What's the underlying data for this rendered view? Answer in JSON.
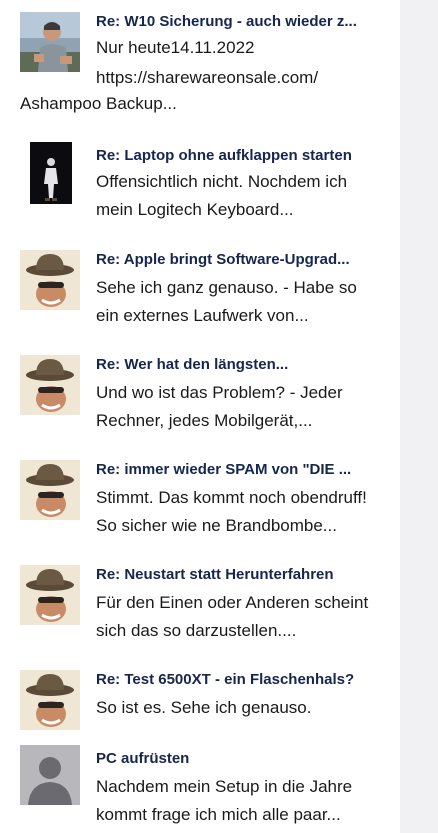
{
  "posts": [
    {
      "title": "Re: W10 Sicherung - auch wieder z...",
      "lines": [
        "Nur heute14.11.2022",
        "https://sharewareonsale.com/",
        "Ashampoo Backup..."
      ],
      "avatar": "avatar-photo-icon"
    },
    {
      "title": "Re: Laptop ohne aufklappen starten",
      "lines": [
        "Offensichtlich nicht. Nochdem ich",
        "mein Logitech Keyboard..."
      ],
      "avatar": "avatar-figure-icon"
    },
    {
      "title": "Re: Apple bringt Software-Upgrad...",
      "lines": [
        "Sehe ich ganz genauso. - Habe so",
        "ein externes Laufwerk von..."
      ],
      "avatar": "avatar-hat-man-icon"
    },
    {
      "title": "Re: Wer hat den längsten...",
      "lines": [
        "Und wo ist das Problem? - Jeder",
        "Rechner, jedes Mobilgerät,..."
      ],
      "avatar": "avatar-hat-man-icon"
    },
    {
      "title": "Re: immer wieder SPAM von \"DIE ...",
      "lines": [
        "Stimmt. Das kommt noch obendruff!",
        "So sicher wie ne Brandbombe..."
      ],
      "avatar": "avatar-hat-man-icon"
    },
    {
      "title": "Re: Neustart statt Herunterfahren",
      "lines": [
        "Für den Einen oder Anderen scheint",
        "sich das so darzustellen...."
      ],
      "avatar": "avatar-hat-man-icon"
    },
    {
      "title": "Re: Test 6500XT - ein Flaschenhals?",
      "lines": [
        "So ist es. Sehe ich genauso."
      ],
      "avatar": "avatar-hat-man-icon"
    },
    {
      "title": "PC aufrüsten",
      "lines": [
        "Nachdem mein Setup in die Jahre",
        "kommt frage ich mich alle paar..."
      ],
      "avatar": "default-user-icon"
    }
  ]
}
